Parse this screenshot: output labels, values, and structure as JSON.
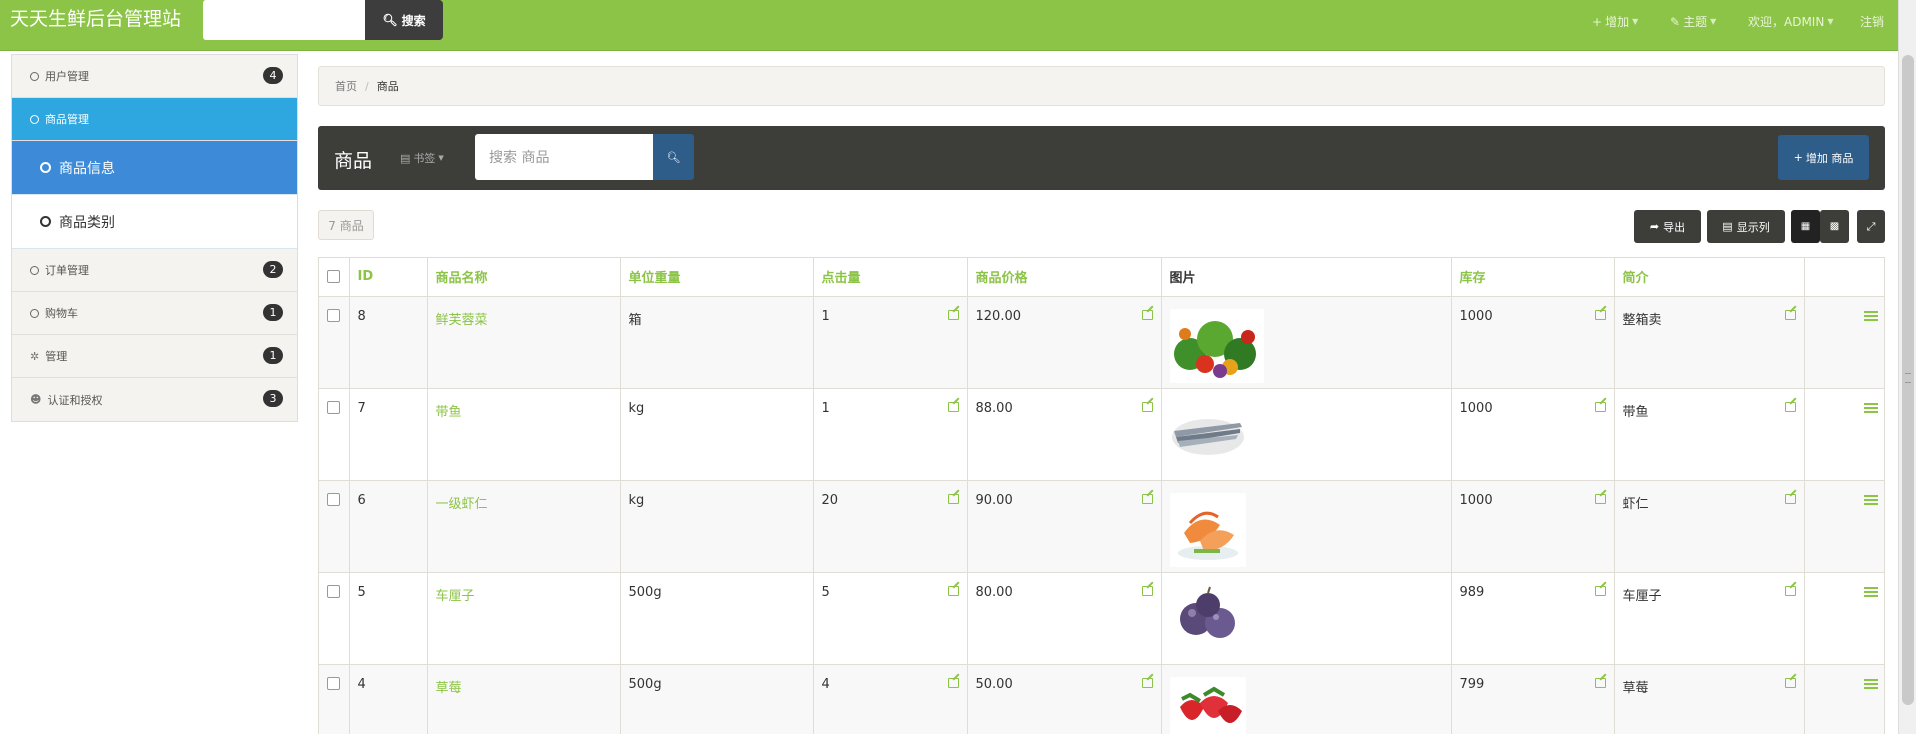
{
  "brand": "天天生鲜后台管理站",
  "top_search": {
    "button": "搜索"
  },
  "top_right": {
    "add": "增加",
    "theme": "主题",
    "welcome": "欢迎，ADMIN",
    "logout": "注销"
  },
  "sidebar": {
    "items": [
      {
        "label": "用户管理",
        "badge": "4"
      },
      {
        "label": "商品管理"
      },
      {
        "label": "订单管理",
        "badge": "2"
      },
      {
        "label": "购物车",
        "badge": "1"
      },
      {
        "label": "管理",
        "badge": "1"
      },
      {
        "label": "认证和授权",
        "badge": "3"
      }
    ],
    "subitems": [
      {
        "label": "商品信息"
      },
      {
        "label": "商品类别"
      }
    ]
  },
  "breadcrumb": {
    "home": "首页",
    "current": "商品"
  },
  "panel": {
    "title": "商品",
    "bookmark": "书签",
    "search_placeholder": "搜索 商品",
    "add_button": "增加 商品"
  },
  "toolbar": {
    "count": "7 商品",
    "export": "导出",
    "columns": "显示列"
  },
  "table": {
    "headers": [
      "ID",
      "商品名称",
      "单位重量",
      "点击量",
      "商品价格",
      "图片",
      "库存",
      "简介"
    ],
    "rows": [
      {
        "id": "8",
        "name": "鲜芙蓉菜",
        "unit": "箱",
        "clicks": "1",
        "price": "120.00",
        "stock": "1000",
        "desc": "整箱卖",
        "pic": "vegetables"
      },
      {
        "id": "7",
        "name": "带鱼",
        "unit": "kg",
        "clicks": "1",
        "price": "88.00",
        "stock": "1000",
        "desc": "带鱼",
        "pic": "fish"
      },
      {
        "id": "6",
        "name": "一级虾仁",
        "unit": "kg",
        "clicks": "20",
        "price": "90.00",
        "stock": "1000",
        "desc": "虾仁",
        "pic": "shrimp"
      },
      {
        "id": "5",
        "name": "车厘子",
        "unit": "500g",
        "clicks": "5",
        "price": "80.00",
        "stock": "989",
        "desc": "车厘子",
        "pic": "plums"
      },
      {
        "id": "4",
        "name": "草莓",
        "unit": "500g",
        "clicks": "4",
        "price": "50.00",
        "stock": "799",
        "desc": "草莓",
        "pic": "strawberries"
      }
    ]
  },
  "colors": {
    "topbar": "#8cc447",
    "active_menu": "#2ea7e0",
    "selected_sub": "#3c8ad8",
    "dark_panel": "#3d3d3a",
    "primary_button": "#2f5d8a"
  }
}
